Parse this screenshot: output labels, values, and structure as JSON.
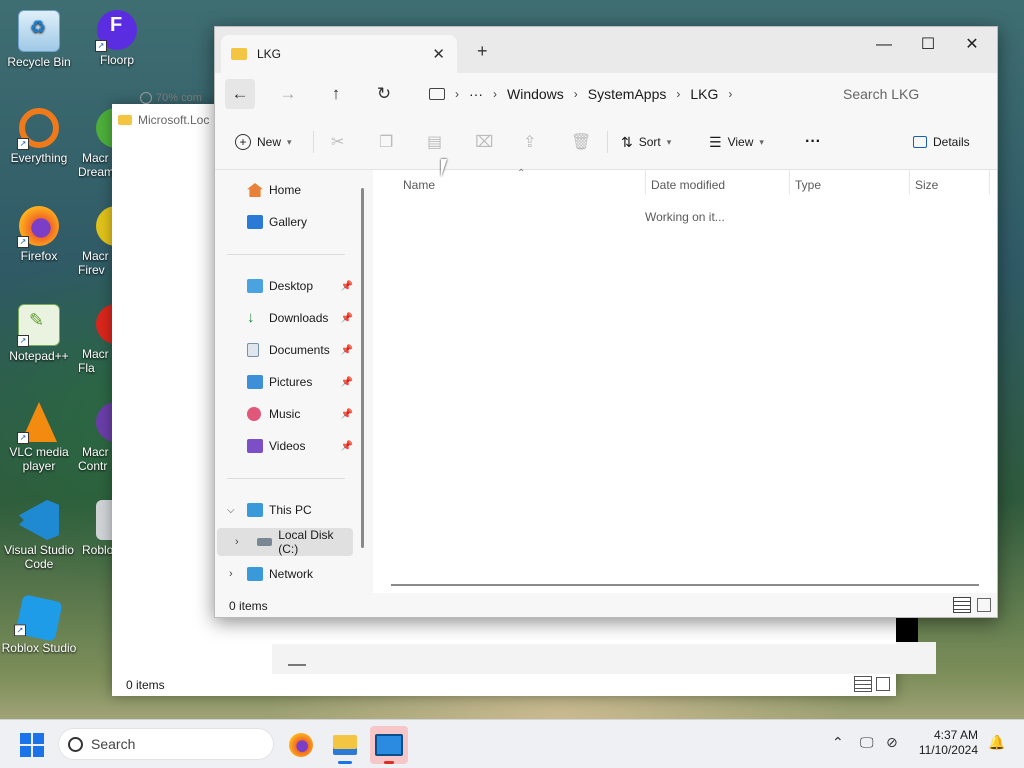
{
  "desktop": {
    "icons": [
      {
        "label": "Recycle Bin"
      },
      {
        "label": "Floorp"
      },
      {
        "label": "Everything"
      },
      {
        "label": "Macr Dream"
      },
      {
        "label": "Firefox"
      },
      {
        "label": "Macr Firev"
      },
      {
        "label": "Notepad++"
      },
      {
        "label": "Macr Fla"
      },
      {
        "label": "VLC media player"
      },
      {
        "label": "Macr Contr"
      },
      {
        "label": "Visual Studio Code"
      },
      {
        "label": "Roblo"
      },
      {
        "label": "Roblox Studio"
      }
    ]
  },
  "bg_window": {
    "tab_title": "Microsoft.Loc",
    "tab2_title": "70% com",
    "status": "0 items"
  },
  "window": {
    "tab_title": "LKG",
    "new_tab": "+",
    "nav": {
      "back": "←",
      "forward": "→",
      "up": "↑",
      "refresh": "↻",
      "more": "···"
    },
    "breadcrumb": [
      "Windows",
      "SystemApps",
      "LKG"
    ],
    "search_placeholder": "Search LKG",
    "toolbar": {
      "new": "New",
      "sort": "Sort",
      "view": "View",
      "more": "···",
      "details": "Details"
    },
    "sidebar": {
      "quick": [
        {
          "label": "Home"
        },
        {
          "label": "Gallery"
        }
      ],
      "pinned": [
        {
          "label": "Desktop"
        },
        {
          "label": "Downloads"
        },
        {
          "label": "Documents"
        },
        {
          "label": "Pictures"
        },
        {
          "label": "Music"
        },
        {
          "label": "Videos"
        }
      ],
      "this_pc": "This PC",
      "local_disk": "Local Disk (C:)",
      "network": "Network"
    },
    "columns": [
      "Name",
      "Date modified",
      "Type",
      "Size"
    ],
    "status_text": "Working on it...",
    "item_count": "0 items"
  },
  "taskbar": {
    "search_placeholder": "Search",
    "time": "4:37 AM",
    "date": "11/10/2024"
  },
  "colors": {
    "accent": "#1a73e8",
    "folder": "#f4c542",
    "selected": "#e0e0e0"
  }
}
